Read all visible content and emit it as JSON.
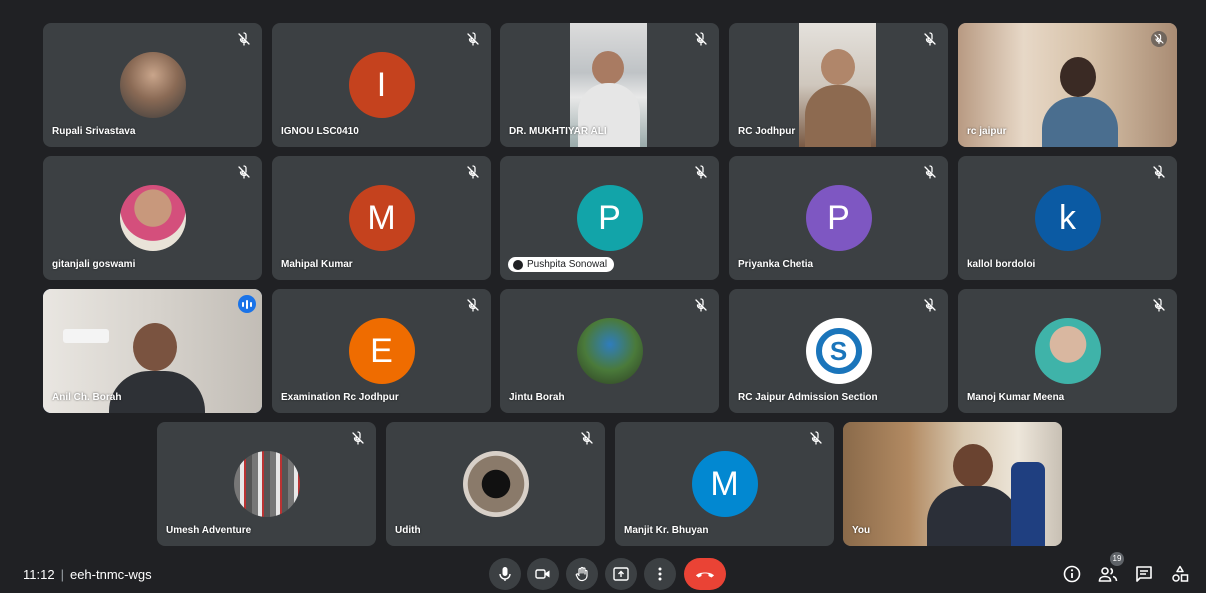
{
  "meeting": {
    "time": "11:12",
    "separator": "|",
    "code": "eeh-tnmc-wgs"
  },
  "participant_count": "19",
  "participants": [
    {
      "name": "Rupali Srivastava",
      "initial": "",
      "color": ""
    },
    {
      "name": "IGNOU LSC0410",
      "initial": "I",
      "color": "#c5421e"
    },
    {
      "name": "DR. MUKHTIYAR ALI",
      "initial": "",
      "color": ""
    },
    {
      "name": "RC Jodhpur",
      "initial": "",
      "color": ""
    },
    {
      "name": "rc jaipur",
      "initial": "",
      "color": ""
    },
    {
      "name": "gitanjali goswami",
      "initial": "",
      "color": ""
    },
    {
      "name": "Mahipal Kumar",
      "initial": "M",
      "color": "#c5421e"
    },
    {
      "name": "Pushpita Sonowal",
      "initial": "P",
      "color": "#12a4a9"
    },
    {
      "name": "Priyanka Chetia",
      "initial": "P",
      "color": "#7e57c2"
    },
    {
      "name": "kallol bordoloi",
      "initial": "k",
      "color": "#0b5aa3"
    },
    {
      "name": "Anil Ch. Borah",
      "initial": "",
      "color": ""
    },
    {
      "name": "Examination Rc Jodhpur",
      "initial": "E",
      "color": "#ef6c00"
    },
    {
      "name": "Jintu Borah",
      "initial": "",
      "color": ""
    },
    {
      "name": "RC Jaipur Admission Section",
      "initial": "",
      "color": ""
    },
    {
      "name": "Manoj Kumar Meena",
      "initial": "",
      "color": ""
    },
    {
      "name": "Umesh Adventure",
      "initial": "",
      "color": ""
    },
    {
      "name": "Udith",
      "initial": "",
      "color": ""
    },
    {
      "name": "Manjit Kr. Bhuyan",
      "initial": "M",
      "color": "#0288d1"
    },
    {
      "name": "You",
      "initial": "",
      "color": ""
    }
  ],
  "controls": {
    "mic": "microphone-icon",
    "camera": "camera-icon",
    "hand": "raise-hand-icon",
    "present": "present-screen-icon",
    "more": "more-options-icon",
    "end": "end-call-icon"
  },
  "colors": {
    "background": "#202124",
    "tile": "#3c4043",
    "accent": "#1a73e8",
    "end_call": "#ea4335"
  }
}
